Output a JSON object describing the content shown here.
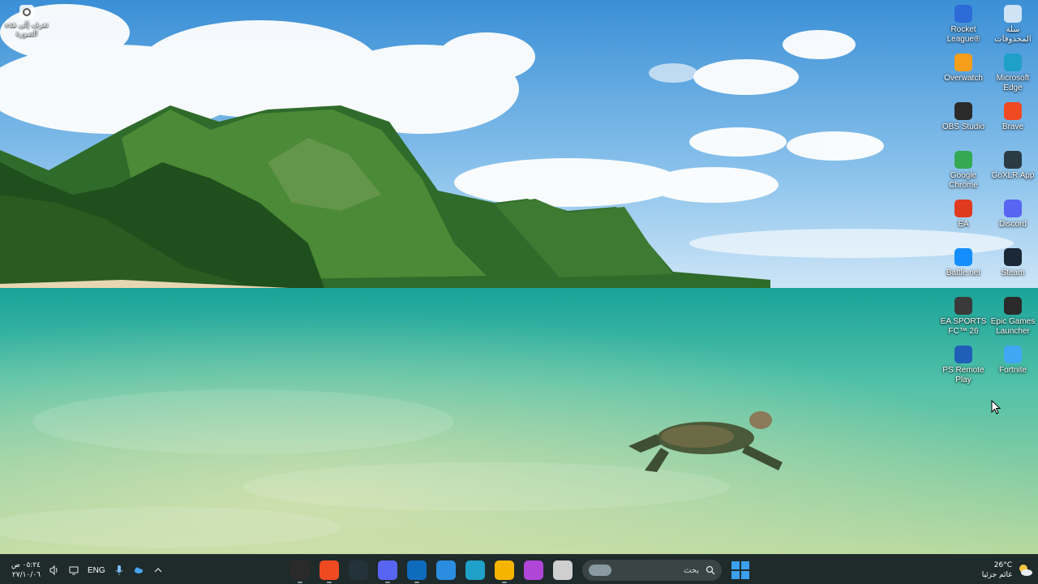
{
  "desktop": {
    "learn_item": {
      "label": "تعرف إلى هذه الصورة"
    },
    "icons_right": [
      {
        "name": "سلة المحذوفات",
        "icon": "recycle-bin-icon",
        "color": "#cfe3f5"
      },
      {
        "name": "Microsoft Edge",
        "icon": "edge-icon",
        "color": "#1fa0c8"
      },
      {
        "name": "Brave",
        "icon": "brave-icon",
        "color": "#f04a23"
      },
      {
        "name": "GoXLR App",
        "icon": "goxlr-icon",
        "color": "#2b3b44"
      },
      {
        "name": "Discord",
        "icon": "discord-icon",
        "color": "#5865f2"
      },
      {
        "name": "Steam",
        "icon": "steam-icon",
        "color": "#1b2838"
      },
      {
        "name": "Epic Games Launcher",
        "icon": "epic-games-icon",
        "color": "#2a2a2a"
      },
      {
        "name": "Fortnite",
        "icon": "fortnite-icon",
        "color": "#3fa8f4"
      }
    ],
    "icons_left": [
      {
        "name": "Rocket League®",
        "icon": "rocket-league-icon",
        "color": "#2d6bd9"
      },
      {
        "name": "Overwatch",
        "icon": "overwatch-icon",
        "color": "#f99e1a"
      },
      {
        "name": "OBS Studio",
        "icon": "obs-icon",
        "color": "#2a2a2a"
      },
      {
        "name": "Google Chrome",
        "icon": "chrome-icon",
        "color": "#34a853"
      },
      {
        "name": "EA",
        "icon": "ea-icon",
        "color": "#e03a1e"
      },
      {
        "name": "Battle.net",
        "icon": "battlenet-icon",
        "color": "#148eff"
      },
      {
        "name": "EA SPORTS FC™ 26",
        "icon": "ea-sports-fc-icon",
        "color": "#3a3a3a"
      },
      {
        "name": "PS Remote Play",
        "icon": "ps-remote-play-icon",
        "color": "#1f5fb8"
      }
    ]
  },
  "taskbar": {
    "clock": {
      "time": "٠٥:٢٤ ص",
      "date": "٢٧/١٠/٠٦"
    },
    "language": "ENG",
    "tray_icons": [
      "volume-icon",
      "display-icon"
    ],
    "tray_left_icons": [
      "mic-icon",
      "onedrive-icon",
      "chevron-up-icon"
    ],
    "apps": [
      {
        "icon": "obs-taskbar-icon",
        "color": "#2a2a2a",
        "text": ""
      },
      {
        "icon": "brave-taskbar-icon",
        "color": "#f04a23",
        "text": ""
      },
      {
        "icon": "goxlr-taskbar-icon",
        "color": "#24333a",
        "text": ""
      },
      {
        "icon": "discord-taskbar-icon",
        "color": "#5865f2",
        "text": ""
      },
      {
        "icon": "outlook-taskbar-icon",
        "color": "#0f6cbd",
        "text": ""
      },
      {
        "icon": "store-taskbar-icon",
        "color": "#2b8de0",
        "text": ""
      },
      {
        "icon": "edge-taskbar-icon",
        "color": "#1fa0c8",
        "text": ""
      },
      {
        "icon": "file-explorer-taskbar-icon",
        "color": "#f4b400",
        "text": ""
      },
      {
        "icon": "office-taskbar-icon",
        "color": "#b046d8",
        "text": ""
      },
      {
        "icon": "window-taskbar-icon",
        "color": "#cfcfcf",
        "text": ""
      }
    ],
    "search": {
      "placeholder": "بحث"
    },
    "weather": {
      "temp": "26°C",
      "condition": "غائم جزئيا"
    }
  }
}
